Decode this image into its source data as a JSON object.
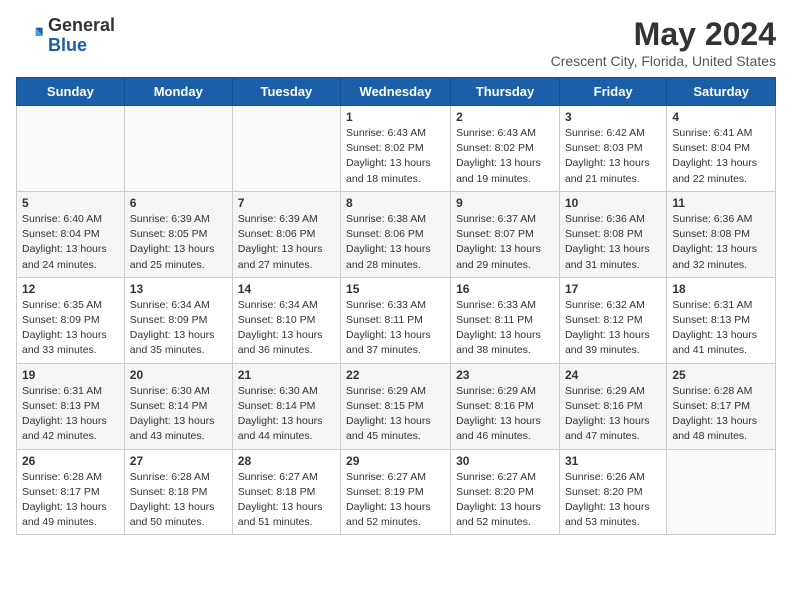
{
  "header": {
    "logo_general": "General",
    "logo_blue": "Blue",
    "month": "May 2024",
    "location": "Crescent City, Florida, United States"
  },
  "days_of_week": [
    "Sunday",
    "Monday",
    "Tuesday",
    "Wednesday",
    "Thursday",
    "Friday",
    "Saturday"
  ],
  "weeks": [
    [
      {
        "day": "",
        "info": ""
      },
      {
        "day": "",
        "info": ""
      },
      {
        "day": "",
        "info": ""
      },
      {
        "day": "1",
        "info": "Sunrise: 6:43 AM\nSunset: 8:02 PM\nDaylight: 13 hours\nand 18 minutes."
      },
      {
        "day": "2",
        "info": "Sunrise: 6:43 AM\nSunset: 8:02 PM\nDaylight: 13 hours\nand 19 minutes."
      },
      {
        "day": "3",
        "info": "Sunrise: 6:42 AM\nSunset: 8:03 PM\nDaylight: 13 hours\nand 21 minutes."
      },
      {
        "day": "4",
        "info": "Sunrise: 6:41 AM\nSunset: 8:04 PM\nDaylight: 13 hours\nand 22 minutes."
      }
    ],
    [
      {
        "day": "5",
        "info": "Sunrise: 6:40 AM\nSunset: 8:04 PM\nDaylight: 13 hours\nand 24 minutes."
      },
      {
        "day": "6",
        "info": "Sunrise: 6:39 AM\nSunset: 8:05 PM\nDaylight: 13 hours\nand 25 minutes."
      },
      {
        "day": "7",
        "info": "Sunrise: 6:39 AM\nSunset: 8:06 PM\nDaylight: 13 hours\nand 27 minutes."
      },
      {
        "day": "8",
        "info": "Sunrise: 6:38 AM\nSunset: 8:06 PM\nDaylight: 13 hours\nand 28 minutes."
      },
      {
        "day": "9",
        "info": "Sunrise: 6:37 AM\nSunset: 8:07 PM\nDaylight: 13 hours\nand 29 minutes."
      },
      {
        "day": "10",
        "info": "Sunrise: 6:36 AM\nSunset: 8:08 PM\nDaylight: 13 hours\nand 31 minutes."
      },
      {
        "day": "11",
        "info": "Sunrise: 6:36 AM\nSunset: 8:08 PM\nDaylight: 13 hours\nand 32 minutes."
      }
    ],
    [
      {
        "day": "12",
        "info": "Sunrise: 6:35 AM\nSunset: 8:09 PM\nDaylight: 13 hours\nand 33 minutes."
      },
      {
        "day": "13",
        "info": "Sunrise: 6:34 AM\nSunset: 8:09 PM\nDaylight: 13 hours\nand 35 minutes."
      },
      {
        "day": "14",
        "info": "Sunrise: 6:34 AM\nSunset: 8:10 PM\nDaylight: 13 hours\nand 36 minutes."
      },
      {
        "day": "15",
        "info": "Sunrise: 6:33 AM\nSunset: 8:11 PM\nDaylight: 13 hours\nand 37 minutes."
      },
      {
        "day": "16",
        "info": "Sunrise: 6:33 AM\nSunset: 8:11 PM\nDaylight: 13 hours\nand 38 minutes."
      },
      {
        "day": "17",
        "info": "Sunrise: 6:32 AM\nSunset: 8:12 PM\nDaylight: 13 hours\nand 39 minutes."
      },
      {
        "day": "18",
        "info": "Sunrise: 6:31 AM\nSunset: 8:13 PM\nDaylight: 13 hours\nand 41 minutes."
      }
    ],
    [
      {
        "day": "19",
        "info": "Sunrise: 6:31 AM\nSunset: 8:13 PM\nDaylight: 13 hours\nand 42 minutes."
      },
      {
        "day": "20",
        "info": "Sunrise: 6:30 AM\nSunset: 8:14 PM\nDaylight: 13 hours\nand 43 minutes."
      },
      {
        "day": "21",
        "info": "Sunrise: 6:30 AM\nSunset: 8:14 PM\nDaylight: 13 hours\nand 44 minutes."
      },
      {
        "day": "22",
        "info": "Sunrise: 6:29 AM\nSunset: 8:15 PM\nDaylight: 13 hours\nand 45 minutes."
      },
      {
        "day": "23",
        "info": "Sunrise: 6:29 AM\nSunset: 8:16 PM\nDaylight: 13 hours\nand 46 minutes."
      },
      {
        "day": "24",
        "info": "Sunrise: 6:29 AM\nSunset: 8:16 PM\nDaylight: 13 hours\nand 47 minutes."
      },
      {
        "day": "25",
        "info": "Sunrise: 6:28 AM\nSunset: 8:17 PM\nDaylight: 13 hours\nand 48 minutes."
      }
    ],
    [
      {
        "day": "26",
        "info": "Sunrise: 6:28 AM\nSunset: 8:17 PM\nDaylight: 13 hours\nand 49 minutes."
      },
      {
        "day": "27",
        "info": "Sunrise: 6:28 AM\nSunset: 8:18 PM\nDaylight: 13 hours\nand 50 minutes."
      },
      {
        "day": "28",
        "info": "Sunrise: 6:27 AM\nSunset: 8:18 PM\nDaylight: 13 hours\nand 51 minutes."
      },
      {
        "day": "29",
        "info": "Sunrise: 6:27 AM\nSunset: 8:19 PM\nDaylight: 13 hours\nand 52 minutes."
      },
      {
        "day": "30",
        "info": "Sunrise: 6:27 AM\nSunset: 8:20 PM\nDaylight: 13 hours\nand 52 minutes."
      },
      {
        "day": "31",
        "info": "Sunrise: 6:26 AM\nSunset: 8:20 PM\nDaylight: 13 hours\nand 53 minutes."
      },
      {
        "day": "",
        "info": ""
      }
    ]
  ]
}
